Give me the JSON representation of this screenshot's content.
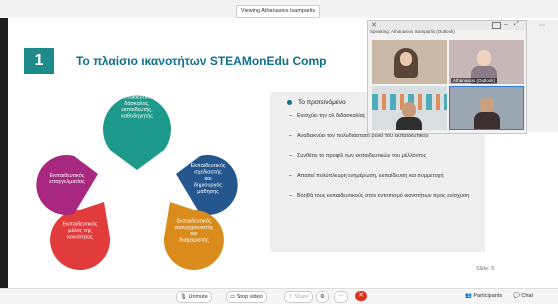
{
  "meeting": {
    "viewing_label": "Viewing Athanasios Isamparlis",
    "speaking_label": "Speaking: Athanasios Isamparlis (Outlook)"
  },
  "slide": {
    "number": "1",
    "title": "Το πλαίσιο ικανοτήτων STEAMonEdu Comp",
    "slide_indicator": "Slide: 5",
    "diagram": {
      "drops": [
        {
          "label": "Εκπαιδευτικός δάσκαλος, εκπαιδευτής, καθοδηγητής",
          "color": "#1e9a8c"
        },
        {
          "label": "Εκπαιδευτικός σχεδιαστής και δημιουργός μάθησης",
          "color": "#24578e"
        },
        {
          "label": "Εκπαιδευτικός εκσυγχρονιστής και διαχειριστής",
          "color": "#d98b1c"
        },
        {
          "label": "Εκπαιδευτικός μέλος της κοινότητας",
          "color": "#e23b3b"
        },
        {
          "label": "Εκπαιδευτικός επαγγελματίας",
          "color": "#a8277f"
        }
      ]
    },
    "bullets": {
      "main": "Το προτεινόμενο",
      "items": [
        "Ενισχύει την ολ διδασκαλίας",
        "Αναδεικνύει τον πολυδιάστατο ρόλο του εκπαιδευτικού",
        "Συνθέτει το προφίλ των εκπαιδευτικών του μέλλοντος",
        "Απαιτεί πολύπλευρη ενημέρωση, εκπαίδευση και συμμετοχή",
        "Βοηθά τους εκπαιδευτικούς στον εντοπισμό ικανοτήτων προς ενίσχυση"
      ]
    }
  },
  "video": {
    "tiles": [
      {
        "label": ""
      },
      {
        "label": "Athanasios (Outlook)"
      },
      {
        "label": ""
      },
      {
        "label": ""
      }
    ]
  },
  "bottom_bar": {
    "unmute": "Unmute",
    "stop_video": "Stop video",
    "share": "Share",
    "participants": "Participants",
    "chat": "Chat"
  },
  "colors": {
    "title": "#0f6f8f",
    "number_box": "#1f8a8a",
    "leave": "#e0301e"
  }
}
